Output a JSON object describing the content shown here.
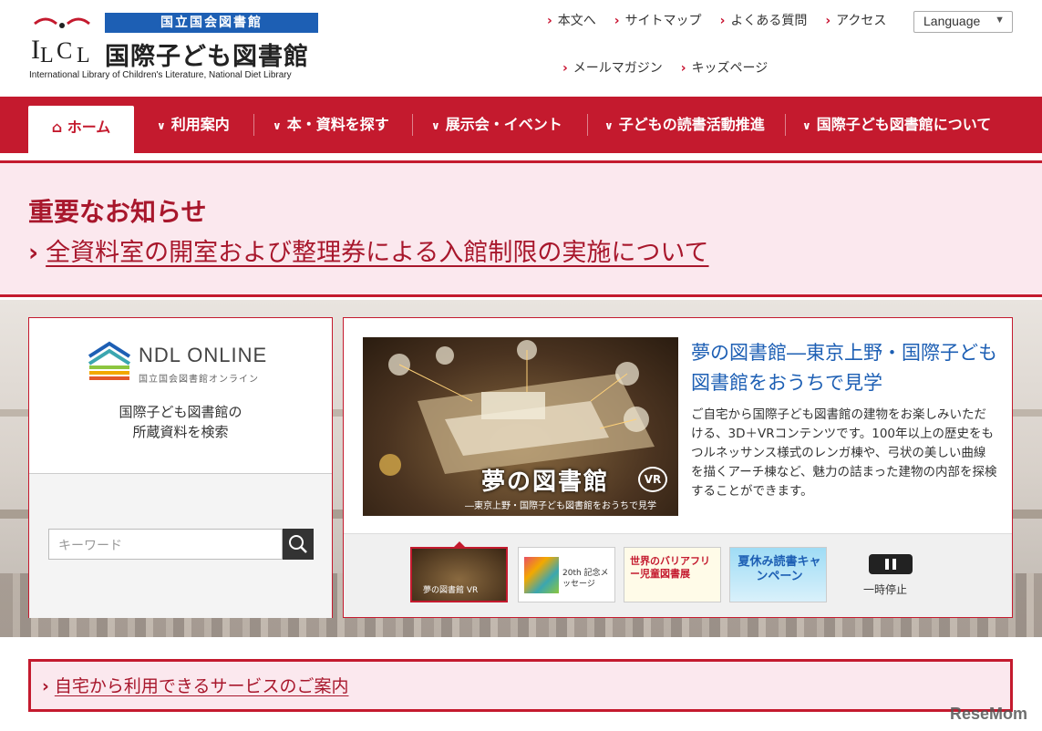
{
  "header": {
    "logo_abbr": "ILCL",
    "logo_ndl": "国立国会図書館",
    "logo_main": "国際子ども図書館",
    "logo_en": "International Library of Children's Literature, National Diet Library"
  },
  "util_nav": {
    "row1": [
      "本文へ",
      "サイトマップ",
      "よくある質問",
      "アクセス"
    ],
    "row2": [
      "メールマガジン",
      "キッズページ"
    ],
    "language": "Language"
  },
  "gnav": {
    "home": "ホーム",
    "items": [
      "利用案内",
      "本・資料を探す",
      "展示会・イベント",
      "子どもの読書活動推進",
      "国際子ども図書館について"
    ]
  },
  "notice": {
    "title": "重要なお知らせ",
    "link": "全資料室の開室および整理券による入館制限の実施について"
  },
  "search": {
    "ndl_title": "NDL ONLINE",
    "ndl_sub": "国立国会図書館オンライン",
    "desc_line1": "国際子ども図書館の",
    "desc_line2": "所蔵資料を検索",
    "placeholder": "キーワード"
  },
  "feature": {
    "image_title": "夢の図書館",
    "image_badge": "VR",
    "image_sub": "―東京上野・国際子ども図書館をおうちで見学",
    "title": "夢の図書館―東京上野・国際子ども図書館をおうちで見学",
    "desc": "ご自宅から国際子ども図書館の建物をお楽しみいただける、3D＋VRコンテンツです。100年以上の歴史をもつルネッサンス様式のレンガ棟や、弓状の美しい曲線を描くアーチ棟など、魅力の詰まった建物の内部を探検することができます。",
    "thumbs": [
      {
        "label": "夢の図書館 VR"
      },
      {
        "label": "20th 記念メッセージ"
      },
      {
        "label": "世界のバリアフリー児童図書展"
      },
      {
        "label": "夏休み読書キャンペーン"
      }
    ],
    "pause_label": "一時停止"
  },
  "services": {
    "link": "自宅から利用できるサービスのご案内"
  },
  "watermark": "ReseMom",
  "colors": {
    "brand_red": "#c41a2e",
    "notice_bg": "#fbe8ee",
    "link_blue": "#1d5fb4"
  }
}
